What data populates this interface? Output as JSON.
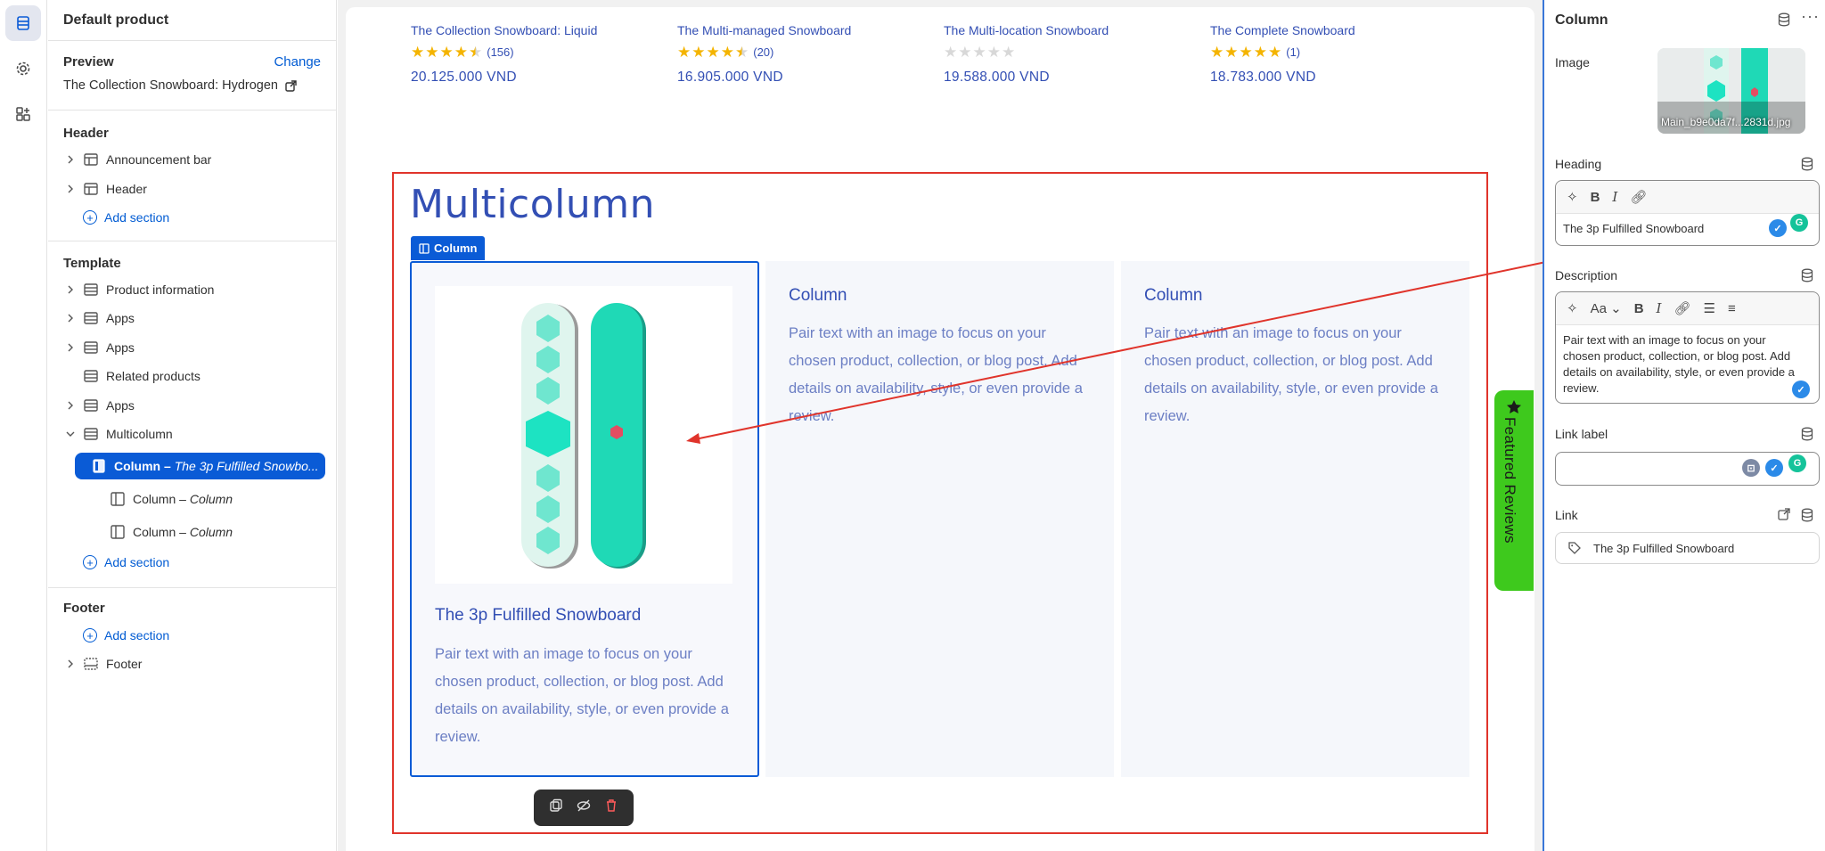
{
  "sidebar": {
    "title": "Default product",
    "preview_label": "Preview",
    "change_label": "Change",
    "preview_value": "The Collection Snowboard: Hydrogen",
    "header_group": "Header",
    "header_items": [
      "Announcement bar",
      "Header"
    ],
    "add_section": "Add section",
    "template_group": "Template",
    "template_items": [
      "Product information",
      "Apps",
      "Apps",
      "Related products",
      "Apps",
      "Multicolumn"
    ],
    "column_prefix": "Column",
    "selected_column_name": "The 3p Fulfilled Snowbo...",
    "column_child_name": "Column",
    "footer_group": "Footer",
    "footer_item": "Footer"
  },
  "products": [
    {
      "name": "The Collection Snowboard: Liquid",
      "rating": 4.5,
      "reviews": "(156)",
      "price": "20.125.000 VND"
    },
    {
      "name": "The Multi-managed Snowboard",
      "rating": 4.5,
      "reviews": "(20)",
      "price": "16.905.000 VND"
    },
    {
      "name": "The Multi-location Snowboard",
      "rating": 0,
      "reviews": "",
      "price": "19.588.000 VND"
    },
    {
      "name": "The Complete Snowboard",
      "rating": 5,
      "reviews": "(1)",
      "price": "18.783.000 VND"
    }
  ],
  "multicolumn": {
    "title": "Multicolumn",
    "tag": "Column",
    "col1_heading": "The 3p Fulfilled Snowboard",
    "col_heading": "Column",
    "description": "Pair text with an image to focus on your chosen product, collection, or blog post. Add details on availability, style, or even provide a review."
  },
  "featured_reviews": "Featured Reviews",
  "panel": {
    "title": "Column",
    "image_label": "Image",
    "image_caption": "Main_b9e0da7f...2831d.jpg",
    "heading_label": "Heading",
    "heading_value": "The 3p Fulfilled Snowboard",
    "description_label": "Description",
    "description_value": "Pair text with an image to focus on your chosen product, collection, or blog post. Add details on availability, style, or even provide a review.",
    "link_label_label": "Link label",
    "link_label_value": "",
    "link_label": "Link",
    "link_value": "The 3p Fulfilled Snowboard",
    "font_btn": "Aa"
  },
  "colors": {
    "accent": "#0a5bd6",
    "outline": "#e0342b",
    "brand_text": "#334fb4",
    "featured": "#3ec91d"
  }
}
